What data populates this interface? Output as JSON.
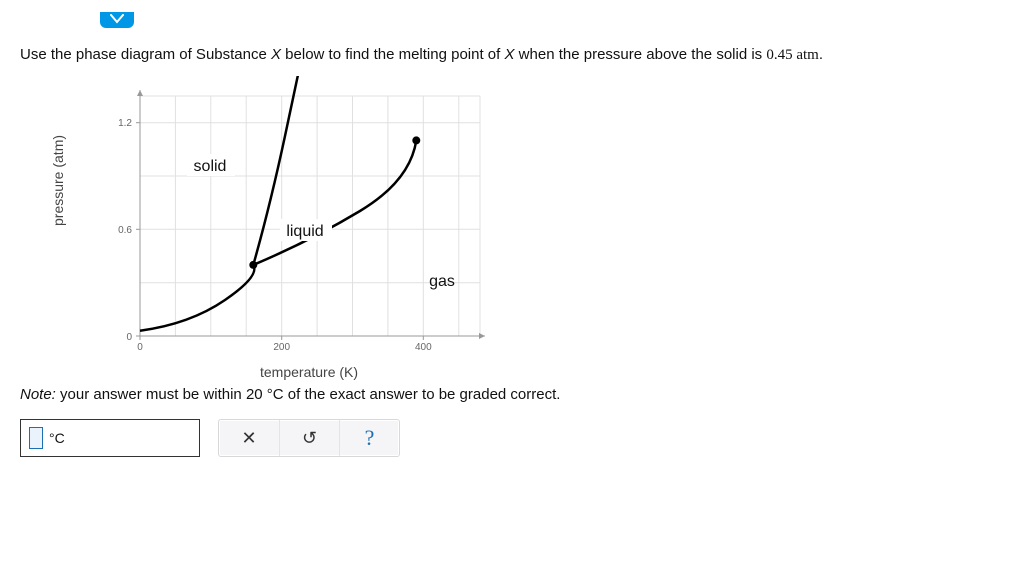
{
  "question": {
    "prefix": "Use the phase diagram of Substance ",
    "subst": "X",
    "mid1": " below to find the melting point of ",
    "subst2": "X",
    "mid2": " when the pressure above the solid is ",
    "pressure_val": "0.45 atm",
    "suffix": "."
  },
  "note": {
    "lead": "Note:",
    "rest_a": " your answer must be within ",
    "tol": "20 °C",
    "rest_b": " of the exact answer to be graded correct."
  },
  "answer": {
    "unit": "°C"
  },
  "buttons": {
    "clear": "✕",
    "reset": "↺",
    "help": "?"
  },
  "chart_data": {
    "type": "line",
    "title": "",
    "xlabel": "temperature (K)",
    "ylabel": "pressure (atm)",
    "xlim": [
      0,
      480
    ],
    "ylim": [
      0,
      1.35
    ],
    "x_ticks": [
      0,
      200,
      400
    ],
    "y_ticks": [
      0,
      0.6,
      1.2
    ],
    "regions": [
      {
        "name": "solid",
        "label_at": {
          "x": 100,
          "y": 0.95
        }
      },
      {
        "name": "liquid",
        "label_at": {
          "x": 230,
          "y": 0.6
        }
      },
      {
        "name": "gas",
        "label_at": {
          "x": 390,
          "y": 0.3
        }
      }
    ],
    "series": [
      {
        "name": "solid-gas",
        "x": [
          0,
          40,
          80,
          120,
          160
        ],
        "y": [
          0.03,
          0.07,
          0.14,
          0.25,
          0.4
        ]
      },
      {
        "name": "solid-liquid",
        "x": [
          160,
          180,
          200,
          220,
          240
        ],
        "y": [
          0.4,
          0.62,
          0.9,
          1.2,
          1.55
        ]
      },
      {
        "name": "liquid-gas",
        "x": [
          160,
          200,
          250,
          300,
          350,
          390
        ],
        "y": [
          0.4,
          0.5,
          0.62,
          0.77,
          0.94,
          1.1
        ]
      }
    ],
    "triple_point": {
      "x": 160,
      "y": 0.4
    },
    "critical_point": {
      "x": 390,
      "y": 1.1
    }
  }
}
